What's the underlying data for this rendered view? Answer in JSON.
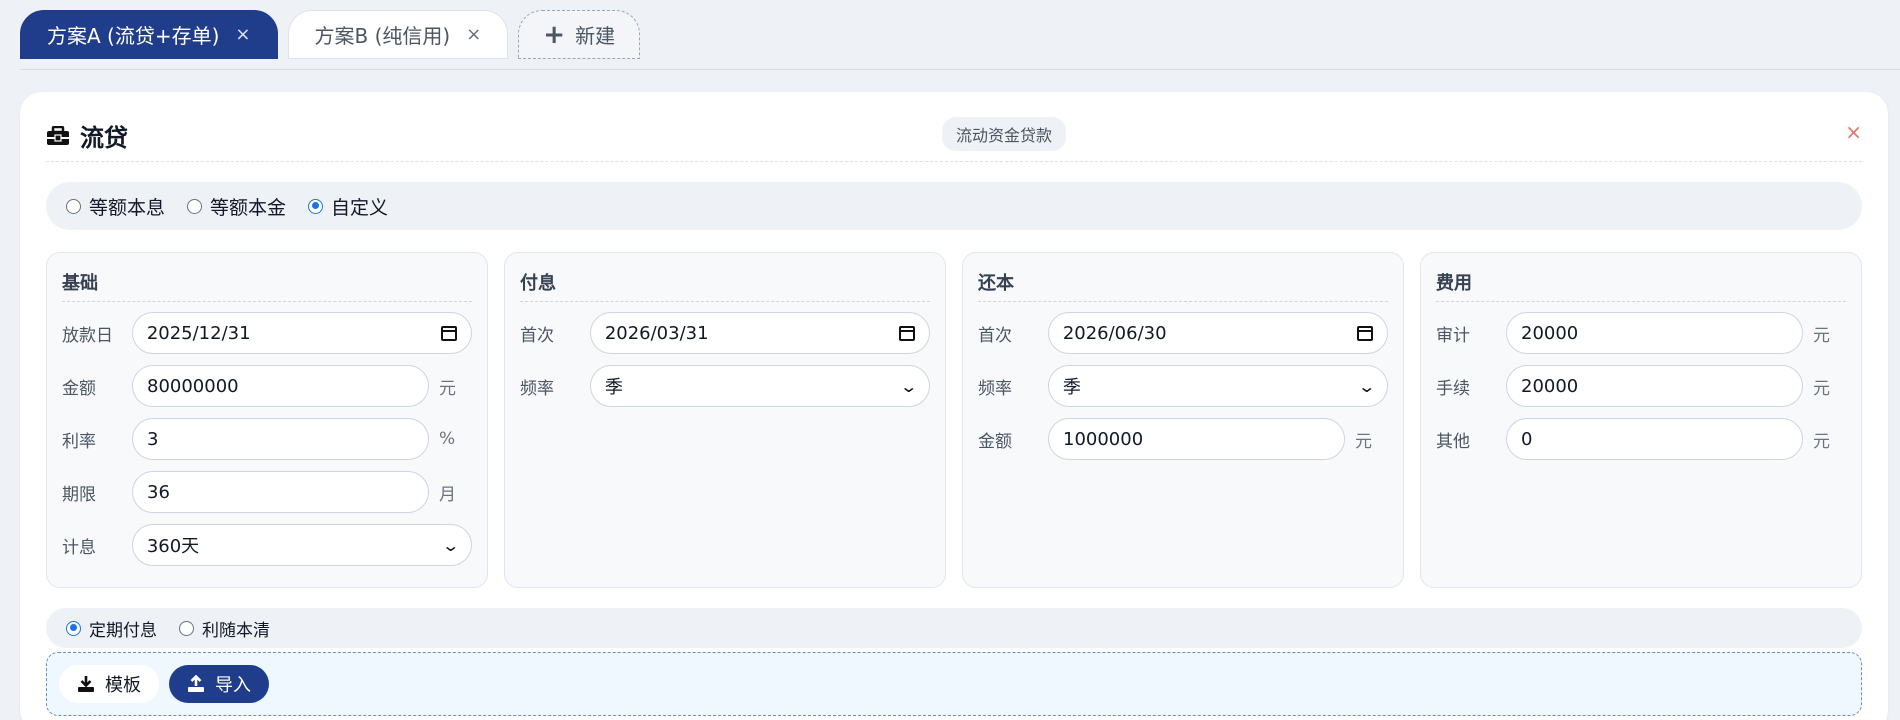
{
  "tabs": [
    {
      "label": "方案A (流贷+存单)",
      "close": "×"
    },
    {
      "label": "方案B (纯信用)",
      "close": "×"
    }
  ],
  "new_tab": {
    "icon": "+",
    "label": "新建"
  },
  "card": {
    "title": "流贷",
    "badge": "流动资金贷款",
    "close": "×",
    "repayment_modes": [
      "等额本息",
      "等额本金",
      "自定义"
    ],
    "repayment_selected": "自定义",
    "interest_modes": [
      "定期付息",
      "利随本清"
    ],
    "interest_selected": "定期付息"
  },
  "panels": {
    "basic": {
      "title": "基础",
      "rows": [
        {
          "label": "放款日",
          "value": "2025/12/31"
        },
        {
          "label": "金额",
          "value": "80000000",
          "unit": "元"
        },
        {
          "label": "利率",
          "value": "3",
          "unit": "%"
        },
        {
          "label": "期限",
          "value": "36",
          "unit": "月"
        },
        {
          "label": "计息",
          "value": "360天"
        }
      ]
    },
    "interest": {
      "title": "付息",
      "rows": [
        {
          "label": "首次",
          "value": "2026/03/31"
        },
        {
          "label": "频率",
          "value": "季"
        }
      ]
    },
    "principal": {
      "title": "还本",
      "rows": [
        {
          "label": "首次",
          "value": "2026/06/30"
        },
        {
          "label": "频率",
          "value": "季"
        },
        {
          "label": "金额",
          "value": "1000000",
          "unit": "元"
        }
      ]
    },
    "fees": {
      "title": "费用",
      "rows": [
        {
          "label": "审计",
          "value": "20000",
          "unit": "元"
        },
        {
          "label": "手续",
          "value": "20000",
          "unit": "元"
        },
        {
          "label": "其他",
          "value": "0",
          "unit": "元"
        }
      ]
    }
  },
  "buttons": {
    "template": "模板",
    "import": "导入"
  }
}
